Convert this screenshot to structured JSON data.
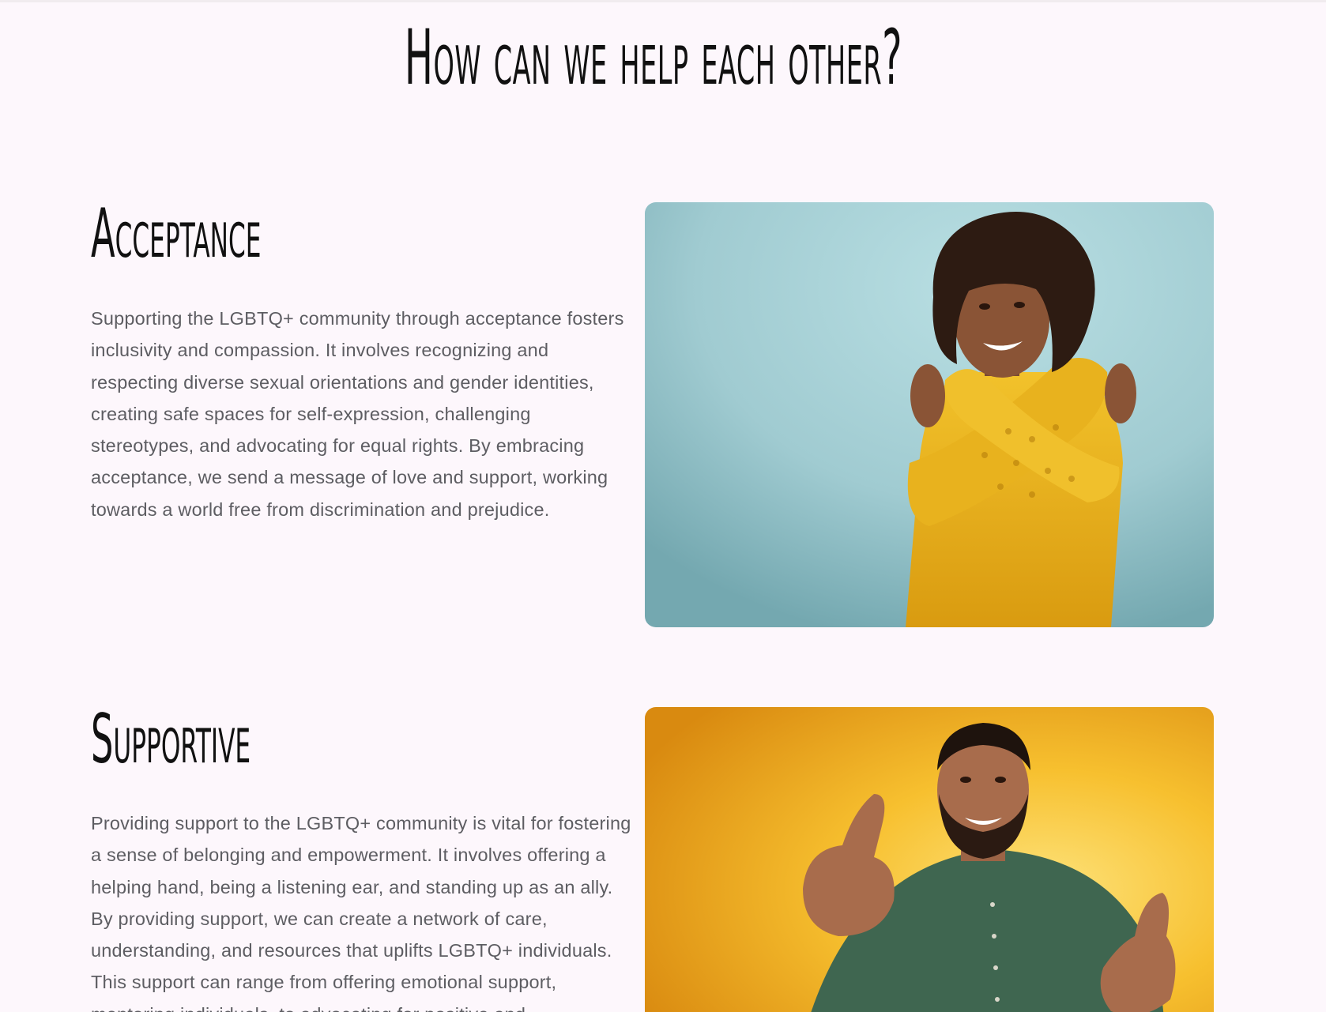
{
  "page": {
    "heading": "How can we help each other?",
    "colors": {
      "background": "#fdf7fc",
      "heading": "#111111",
      "body_text": "#5d5d62"
    }
  },
  "sections": [
    {
      "title": "Acceptance",
      "text": "Supporting the LGBTQ+ community through acceptance fosters inclusivity and compassion. It involves recognizing and respecting diverse sexual orientations and gender identities, creating safe spaces for self-expression, challenging stereotypes, and advocating for equal rights. By embracing acceptance, we send a message of love and support, working towards a world free from discrimination and prejudice.",
      "image_colors": {
        "backdrop": "#a6cfd4",
        "sweater": "#e9b520"
      }
    },
    {
      "title": "Supportive",
      "text": "Providing support to the LGBTQ+ community is vital for fostering a sense of belonging and empowerment. It involves offering a helping hand, being a listening ear, and standing up as an ally. By providing support, we can create a network of care, understanding, and resources that uplifts LGBTQ+ individuals. This support can range from offering emotional support, mentoring individuals, to advocating for positive and",
      "image_colors": {
        "backdrop": "#f3b421",
        "shirt": "#3f6650"
      }
    }
  ]
}
